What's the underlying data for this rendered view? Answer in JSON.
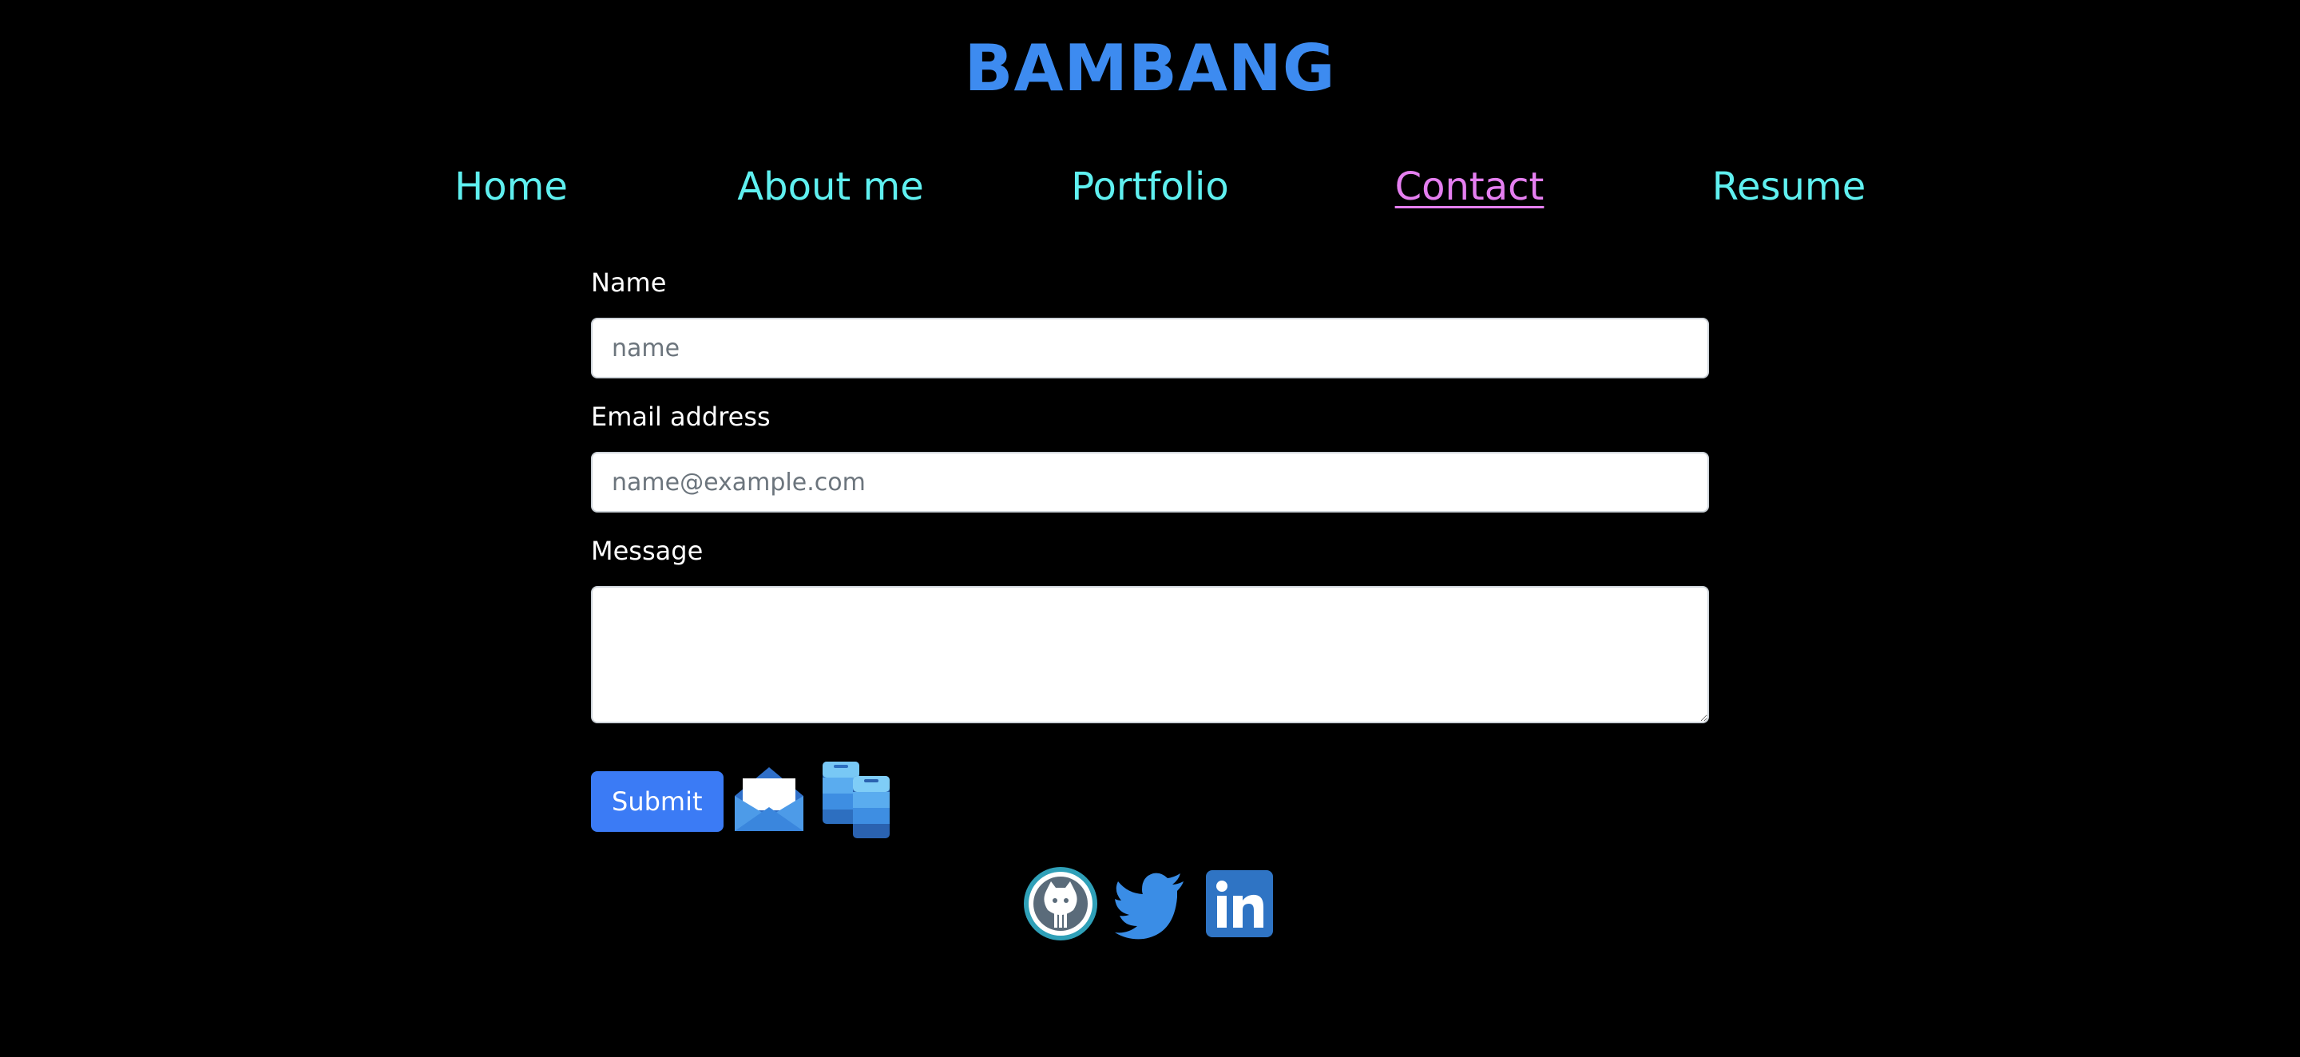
{
  "header": {
    "title": "BAMBANG"
  },
  "nav": {
    "items": [
      {
        "label": "Home"
      },
      {
        "label": "About me"
      },
      {
        "label": "Portfolio"
      },
      {
        "label": "Contact"
      },
      {
        "label": "Resume"
      }
    ],
    "active_index": 3
  },
  "form": {
    "name": {
      "label": "Name",
      "placeholder": "name",
      "value": ""
    },
    "email": {
      "label": "Email address",
      "placeholder": "name@example.com",
      "value": ""
    },
    "message": {
      "label": "Message",
      "value": ""
    },
    "submit_label": "Submit"
  },
  "icons": {
    "mail": "envelope-icon",
    "phone": "phone-icon",
    "github": "github-icon",
    "twitter": "twitter-icon",
    "linkedin": "linkedin-icon"
  },
  "colors": {
    "background": "#000000",
    "title": "#3d8bf0",
    "nav_link": "#5ff0f0",
    "nav_active": "#e57ff0",
    "submit_bg": "#3b7bf5",
    "label": "#ffffff"
  }
}
